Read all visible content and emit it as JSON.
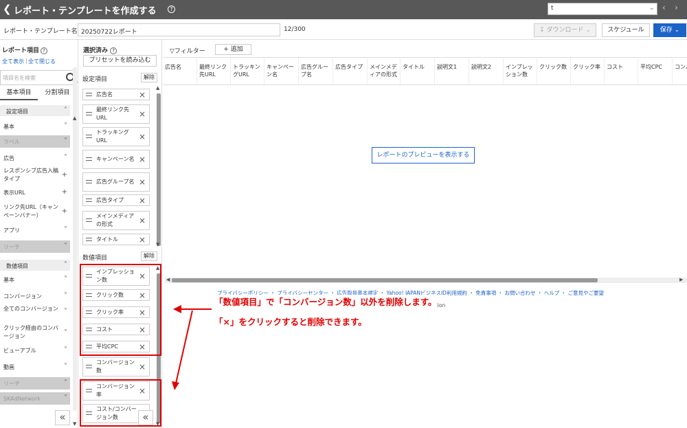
{
  "topbar": {
    "title": "レポート・テンプレートを作成する",
    "account_value": "t"
  },
  "namebar": {
    "label": "レポート・テンプレート名",
    "value": "20250722レポート",
    "count": "12/300"
  },
  "actions": {
    "download": "ダウンロード",
    "schedule": "スケジュール",
    "save": "保存"
  },
  "left": {
    "title": "レポート項目",
    "show_all": "全て表示",
    "close_all": "全て閉じる",
    "search_placeholder": "項目名を検索",
    "tab_basic": "基本項目",
    "tab_split": "分割項目",
    "items": [
      {
        "label": "設定項目",
        "type": "section",
        "icon": "chevron-up"
      },
      {
        "label": "基本",
        "type": "item",
        "icon": "chevron-down"
      },
      {
        "label": "ラベル",
        "type": "disabled",
        "icon": "chevron-down"
      },
      {
        "label": "広告",
        "type": "item",
        "icon": "chevron-up"
      },
      {
        "label": "レスポンシブ広告入稿タイプ",
        "type": "item",
        "icon": "plus"
      },
      {
        "label": "表示URL",
        "type": "item",
        "icon": "plus"
      },
      {
        "label": "リンク先URL（キャンペーンバナー）",
        "type": "item",
        "icon": "plus"
      },
      {
        "label": "アプリ",
        "type": "item",
        "icon": "chevron-down"
      },
      {
        "label": "リーチ",
        "type": "disabled",
        "icon": "chevron-down"
      },
      {
        "label": "数値項目",
        "type": "section",
        "icon": "chevron-up"
      },
      {
        "label": "基本",
        "type": "item",
        "icon": "chevron-down"
      },
      {
        "label": "コンバージョン",
        "type": "item",
        "icon": "chevron-down"
      },
      {
        "label": "全てのコンバージョン",
        "type": "item",
        "icon": "chevron-down"
      },
      {
        "label": "クリック経由のコンバージョン",
        "type": "item",
        "icon": "chevron-down"
      },
      {
        "label": "ビューアブル",
        "type": "item",
        "icon": "chevron-down"
      },
      {
        "label": "動画",
        "type": "item",
        "icon": "chevron-down"
      },
      {
        "label": "リーチ",
        "type": "disabled",
        "icon": "chevron-down"
      },
      {
        "label": "SKAdNetwork",
        "type": "disabled",
        "icon": "chevron-down"
      }
    ]
  },
  "center": {
    "title": "選択済み",
    "preset": "プリセットを読み込む",
    "setting_group": "設定項目",
    "numeric_group": "数値項目",
    "clear": "解除",
    "setting_items": [
      "広告名",
      "最終リンク先URL",
      "トラッキングURL",
      "キャンペーン名",
      "広告グループ名",
      "広告タイプ",
      "メインメディアの形式",
      "タイトル"
    ],
    "numeric_items": [
      "インプレッション数",
      "クリック数",
      "クリック率",
      "コスト",
      "平均CPC",
      "コンバージョン数",
      "コンバージョン率",
      "コスト/コンバージョン数"
    ]
  },
  "main": {
    "filter": "フィルター",
    "add": "追加",
    "columns": [
      "広告名",
      "最終リンク先URL",
      "トラッキングURL",
      "キャンペーン名",
      "広告グループ名",
      "広告タイプ",
      "メインメディアの形式",
      "タイトル",
      "説明文1",
      "説明文2",
      "インプレッション数",
      "クリック数",
      "クリック率",
      "コスト",
      "平均CPC",
      "コンバ"
    ],
    "preview": "レポートのプレビューを表示する"
  },
  "footer": {
    "links": "プライバシーポリシー ・ プライバシーセンター ・ 広告取扱基本規定 ・ Yahoo! JAPANビジネスID利用規約 ・ 免責事項 ・ お問い合わせ ・ ヘルプ ・ ご意見やご要望",
    "copyright": "© LY Corporation"
  },
  "annotation": {
    "line1": "「数値項目」で「コンバージョン数」以外を削除します。",
    "line2": "「×」をクリックすると削除できます。"
  }
}
